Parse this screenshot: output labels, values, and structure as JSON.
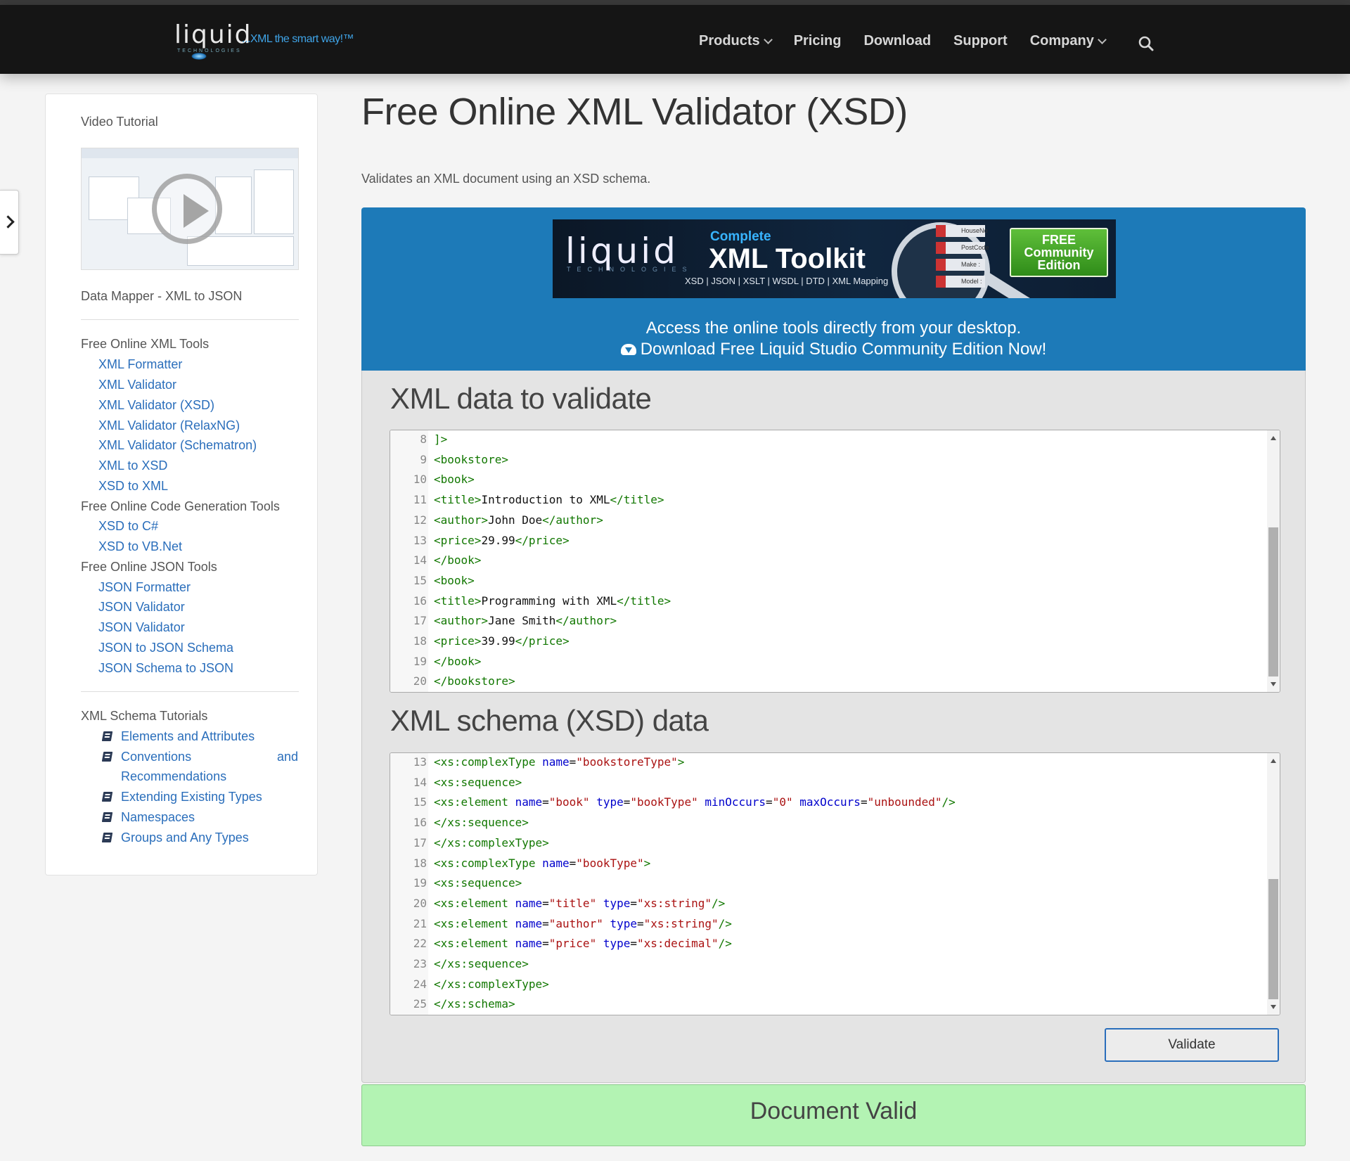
{
  "nav": {
    "logo_word": "liquid",
    "logo_sub": "TECHNOLOGIES",
    "logo_tagline": "...XML the smart way!™",
    "items": [
      "Products",
      "Pricing",
      "Download",
      "Support",
      "Company"
    ]
  },
  "sidebar": {
    "video_label": "Video Tutorial",
    "data_mapper": "Data Mapper - XML to JSON",
    "xml_tools_heading": "Free Online XML Tools",
    "xml_tools": [
      "XML Formatter",
      "XML Validator",
      "XML Validator (XSD)",
      "XML Validator (RelaxNG)",
      "XML Validator (Schematron)",
      "XML to XSD",
      "XSD to XML"
    ],
    "codegen_heading": "Free Online Code Generation Tools",
    "codegen_tools": [
      "XSD to C#",
      "XSD to VB.Net"
    ],
    "json_heading": "Free Online JSON Tools",
    "json_tools": [
      "JSON Formatter",
      "JSON Validator",
      "JSON Validator",
      "JSON to JSON Schema",
      "JSON Schema to JSON"
    ],
    "tutorials_heading": "XML Schema Tutorials",
    "tutorials": [
      "Elements and Attributes",
      "Conventions",
      "and",
      "Recommendations",
      "Extending Existing Types",
      "Namespaces",
      "Groups and Any Types"
    ]
  },
  "main": {
    "title": "Free Online XML Validator (XSD)",
    "description": "Validates an XML document using an XSD schema.",
    "banner": {
      "ad_word": "liquid",
      "ad_tech": "TECHNOLOGIES",
      "ad_complete": "Complete",
      "ad_toolkit": "XML Toolkit",
      "ad_sub": "XSD | JSON | XSLT | WSDL | DTD | XML Mapping",
      "ad_fields": [
        "HouseNo",
        "PostCode",
        "Make : strin",
        "Model :"
      ],
      "ad_free_1": "FREE",
      "ad_free_2": "Community",
      "ad_free_3": "Edition",
      "line1": "Access the online tools directly from your desktop.",
      "line2": "Download Free Liquid Studio Community Edition Now!"
    },
    "xml_section_title": "XML data to validate",
    "xsd_section_title": "XML schema (XSD) data",
    "validate_label": "Validate",
    "result": "Document Valid"
  },
  "xml_editor": {
    "scroll_fraction_top": 0.37,
    "lines": [
      {
        "n": "8",
        "parts": [
          [
            "tag",
            "]>"
          ]
        ]
      },
      {
        "n": "9",
        "parts": [
          [
            "tag",
            "<bookstore>"
          ]
        ]
      },
      {
        "n": "10",
        "parts": [
          [
            "tag",
            "<book>"
          ]
        ]
      },
      {
        "n": "11",
        "parts": [
          [
            "tag",
            "<title>"
          ],
          [
            "txt",
            "Introduction to XML"
          ],
          [
            "tag",
            "</title>"
          ]
        ]
      },
      {
        "n": "12",
        "parts": [
          [
            "tag",
            "<author>"
          ],
          [
            "txt",
            "John Doe"
          ],
          [
            "tag",
            "</author>"
          ]
        ]
      },
      {
        "n": "13",
        "parts": [
          [
            "tag",
            "<price>"
          ],
          [
            "txt",
            "29.99"
          ],
          [
            "tag",
            "</price>"
          ]
        ]
      },
      {
        "n": "14",
        "parts": [
          [
            "tag",
            "</book>"
          ]
        ]
      },
      {
        "n": "15",
        "parts": [
          [
            "tag",
            "<book>"
          ]
        ]
      },
      {
        "n": "16",
        "parts": [
          [
            "tag",
            "<title>"
          ],
          [
            "txt",
            "Programming with XML"
          ],
          [
            "tag",
            "</title>"
          ]
        ]
      },
      {
        "n": "17",
        "parts": [
          [
            "tag",
            "<author>"
          ],
          [
            "txt",
            "Jane Smith"
          ],
          [
            "tag",
            "</author>"
          ]
        ]
      },
      {
        "n": "18",
        "parts": [
          [
            "tag",
            "<price>"
          ],
          [
            "txt",
            "39.99"
          ],
          [
            "tag",
            "</price>"
          ]
        ]
      },
      {
        "n": "19",
        "parts": [
          [
            "tag",
            "</book>"
          ]
        ]
      },
      {
        "n": "20",
        "parts": [
          [
            "tag",
            "</bookstore>"
          ]
        ]
      }
    ]
  },
  "xsd_editor": {
    "scroll_fraction_top": 0.48,
    "lines": [
      {
        "n": "13",
        "parts": [
          [
            "tag",
            "<xs:complexType "
          ],
          [
            "attr",
            "name"
          ],
          [
            "txt",
            "="
          ],
          [
            "val",
            "\"bookstoreType\""
          ],
          [
            "tag",
            ">"
          ]
        ]
      },
      {
        "n": "14",
        "parts": [
          [
            "tag",
            "<xs:sequence>"
          ]
        ]
      },
      {
        "n": "15",
        "parts": [
          [
            "tag",
            "<xs:element "
          ],
          [
            "attr",
            "name"
          ],
          [
            "txt",
            "="
          ],
          [
            "val",
            "\"book\""
          ],
          [
            "txt",
            " "
          ],
          [
            "attr",
            "type"
          ],
          [
            "txt",
            "="
          ],
          [
            "val",
            "\"bookType\""
          ],
          [
            "txt",
            " "
          ],
          [
            "attr",
            "minOccurs"
          ],
          [
            "txt",
            "="
          ],
          [
            "val",
            "\"0\""
          ],
          [
            "txt",
            " "
          ],
          [
            "attr",
            "maxOccurs"
          ],
          [
            "txt",
            "="
          ],
          [
            "val",
            "\"unbounded\""
          ],
          [
            "tag",
            "/>"
          ]
        ]
      },
      {
        "n": "16",
        "parts": [
          [
            "tag",
            "</xs:sequence>"
          ]
        ]
      },
      {
        "n": "17",
        "parts": [
          [
            "tag",
            "</xs:complexType>"
          ]
        ]
      },
      {
        "n": "18",
        "parts": [
          [
            "tag",
            "<xs:complexType "
          ],
          [
            "attr",
            "name"
          ],
          [
            "txt",
            "="
          ],
          [
            "val",
            "\"bookType\""
          ],
          [
            "tag",
            ">"
          ]
        ]
      },
      {
        "n": "19",
        "parts": [
          [
            "tag",
            "<xs:sequence>"
          ]
        ]
      },
      {
        "n": "20",
        "parts": [
          [
            "tag",
            "<xs:element "
          ],
          [
            "attr",
            "name"
          ],
          [
            "txt",
            "="
          ],
          [
            "val",
            "\"title\""
          ],
          [
            "txt",
            " "
          ],
          [
            "attr",
            "type"
          ],
          [
            "txt",
            "="
          ],
          [
            "val",
            "\"xs:string\""
          ],
          [
            "tag",
            "/>"
          ]
        ]
      },
      {
        "n": "21",
        "parts": [
          [
            "tag",
            "<xs:element "
          ],
          [
            "attr",
            "name"
          ],
          [
            "txt",
            "="
          ],
          [
            "val",
            "\"author\""
          ],
          [
            "txt",
            " "
          ],
          [
            "attr",
            "type"
          ],
          [
            "txt",
            "="
          ],
          [
            "val",
            "\"xs:string\""
          ],
          [
            "tag",
            "/>"
          ]
        ]
      },
      {
        "n": "22",
        "parts": [
          [
            "tag",
            "<xs:element "
          ],
          [
            "attr",
            "name"
          ],
          [
            "txt",
            "="
          ],
          [
            "val",
            "\"price\""
          ],
          [
            "txt",
            " "
          ],
          [
            "attr",
            "type"
          ],
          [
            "txt",
            "="
          ],
          [
            "val",
            "\"xs:decimal\""
          ],
          [
            "tag",
            "/>"
          ]
        ]
      },
      {
        "n": "23",
        "parts": [
          [
            "tag",
            "</xs:sequence>"
          ]
        ]
      },
      {
        "n": "24",
        "parts": [
          [
            "tag",
            "</xs:complexType>"
          ]
        ]
      },
      {
        "n": "25",
        "parts": [
          [
            "tag",
            "</xs:schema>"
          ]
        ]
      }
    ]
  }
}
